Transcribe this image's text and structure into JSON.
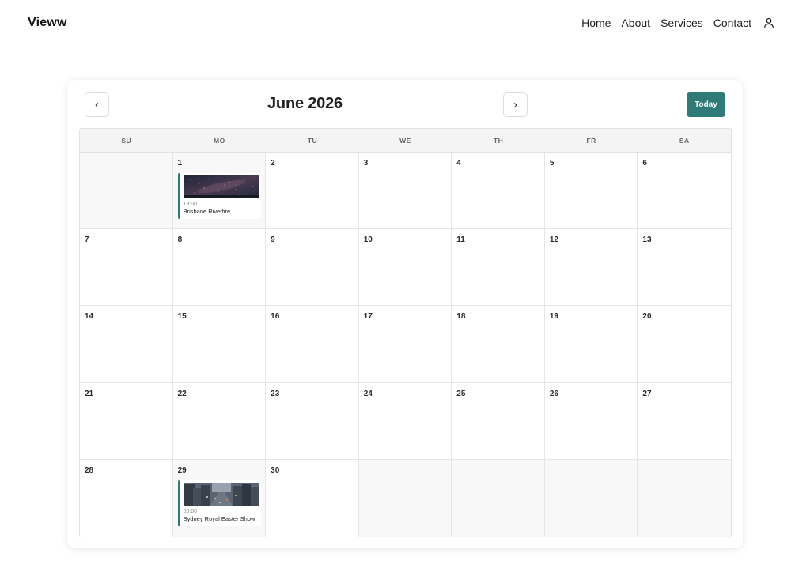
{
  "header": {
    "logo": "Vieww",
    "nav": [
      "Home",
      "About",
      "Services",
      "Contact"
    ],
    "user_icon": "user-icon"
  },
  "calendar": {
    "month_title": "June 2026",
    "prev_label": "‹",
    "next_label": "›",
    "today_label": "Today",
    "accent_color": "#2d7a77",
    "weekdays": [
      "SU",
      "MO",
      "TU",
      "WE",
      "TH",
      "FR",
      "SA"
    ],
    "days": [
      "",
      "1",
      "2",
      "3",
      "4",
      "5",
      "6",
      "7",
      "8",
      "9",
      "10",
      "11",
      "12",
      "13",
      "14",
      "15",
      "16",
      "17",
      "18",
      "19",
      "20",
      "21",
      "22",
      "23",
      "24",
      "25",
      "26",
      "27",
      "28",
      "29",
      "30",
      "",
      "",
      "",
      ""
    ],
    "events": [
      {
        "day": "1",
        "time": "19:00",
        "title": "Brisbane Riverfire",
        "image": "night-sky-image"
      },
      {
        "day": "29",
        "time": "09:00",
        "title": "Sydney Royal Easter Show",
        "image": "city-street-image"
      }
    ]
  }
}
